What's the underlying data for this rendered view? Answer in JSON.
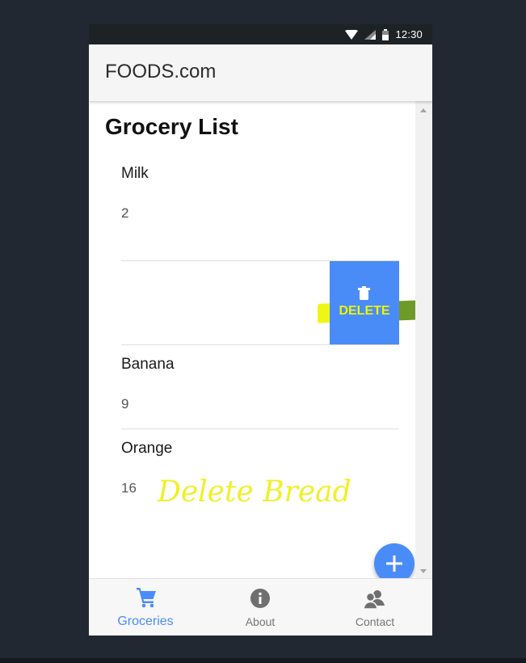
{
  "status_bar": {
    "time": "12:30"
  },
  "app_bar": {
    "title": "FOODS.com"
  },
  "page": {
    "title": "Grocery List"
  },
  "items": [
    {
      "name": "Milk",
      "qty": "2"
    },
    {
      "name": "Banana",
      "qty": "9"
    },
    {
      "name": "Orange",
      "qty": "16"
    }
  ],
  "swipe_action": {
    "label": "DELETE",
    "icon": "trash-icon"
  },
  "annotation": {
    "text": "Delete Bread"
  },
  "fab": {
    "icon": "plus-icon"
  },
  "bottom_nav": {
    "items": [
      {
        "label": "Groceries",
        "icon": "cart-icon",
        "active": true
      },
      {
        "label": "About",
        "icon": "info-icon",
        "active": false
      },
      {
        "label": "Contact",
        "icon": "people-icon",
        "active": false
      }
    ]
  },
  "colors": {
    "accent": "#4a8cf7",
    "highlight": "#eef500",
    "backdrop": "#222831"
  }
}
